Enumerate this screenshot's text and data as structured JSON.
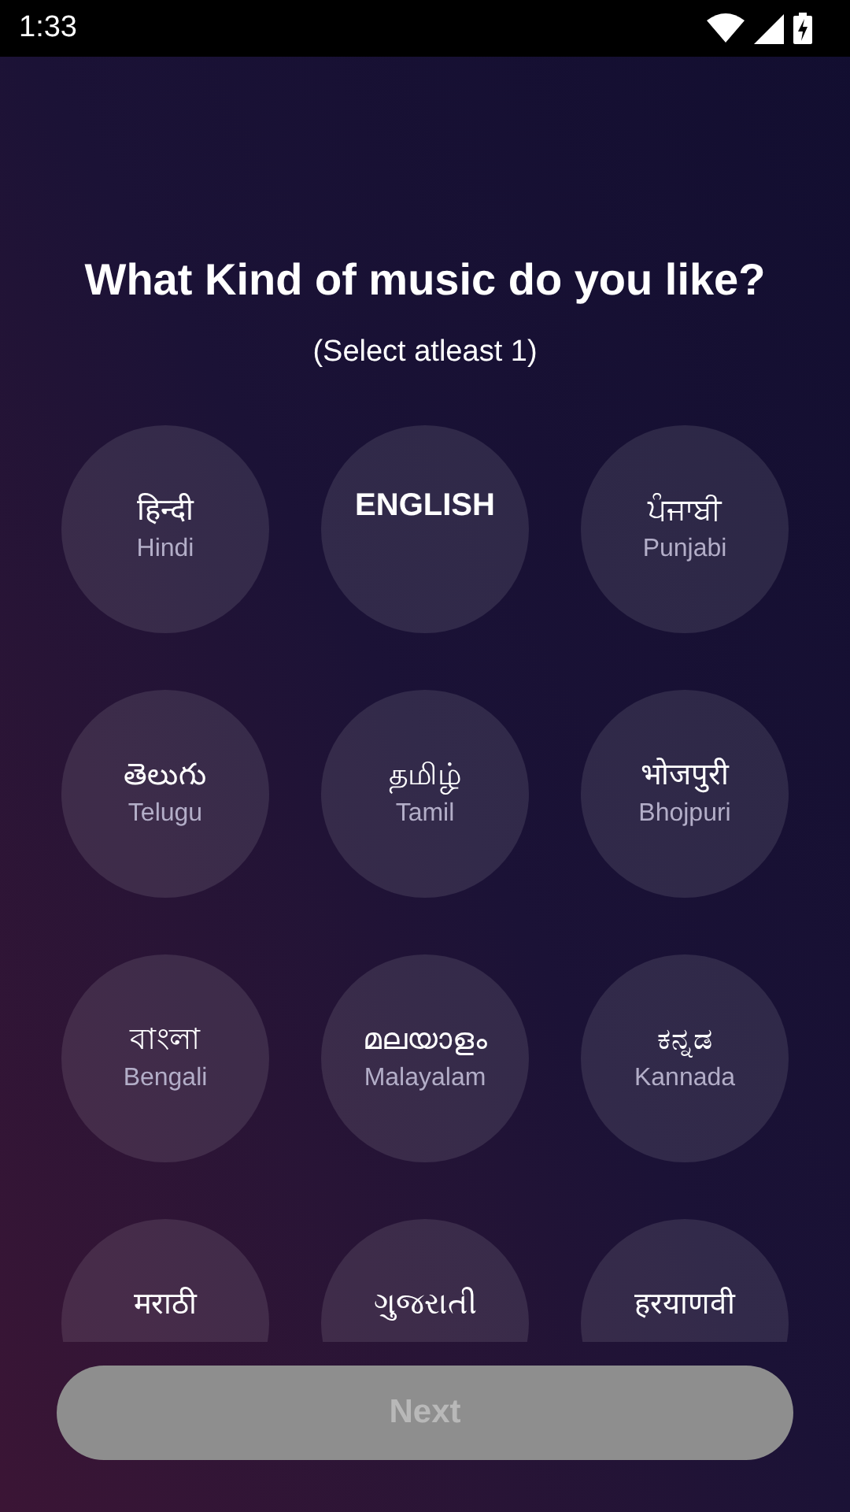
{
  "status_bar": {
    "time": "1:33"
  },
  "title": "What Kind of music do you like?",
  "subtitle": "(Select atleast 1)",
  "languages": [
    {
      "kind": "dual",
      "native": "हिन्दी",
      "english": "Hindi",
      "selected": false
    },
    {
      "kind": "single",
      "native": "ENGLISH",
      "selected": false
    },
    {
      "kind": "dual",
      "native": "ਪੰਜਾਬੀ",
      "english": "Punjabi",
      "selected": false
    },
    {
      "kind": "dual",
      "native": "తెలుగు",
      "english": "Telugu",
      "selected": false
    },
    {
      "kind": "dual",
      "native": "தமிழ்",
      "english": "Tamil",
      "selected": false
    },
    {
      "kind": "dual",
      "native": "भोजपुरी",
      "english": "Bhojpuri",
      "selected": false
    },
    {
      "kind": "dual",
      "native": "বাংলা",
      "english": "Bengali",
      "selected": false
    },
    {
      "kind": "dual",
      "native": "മലയാളം",
      "english": "Malayalam",
      "selected": false
    },
    {
      "kind": "dual",
      "native": "ಕನ್ನಡ",
      "english": "Kannada",
      "selected": false
    },
    {
      "kind": "dual",
      "native": "मराठी",
      "selected": false
    },
    {
      "kind": "dual",
      "native": "ગુજરાતી",
      "selected": false
    },
    {
      "kind": "dual",
      "native": "हरयाणवी",
      "selected": false
    }
  ],
  "next_button": {
    "label": "Next",
    "disabled": true
  }
}
